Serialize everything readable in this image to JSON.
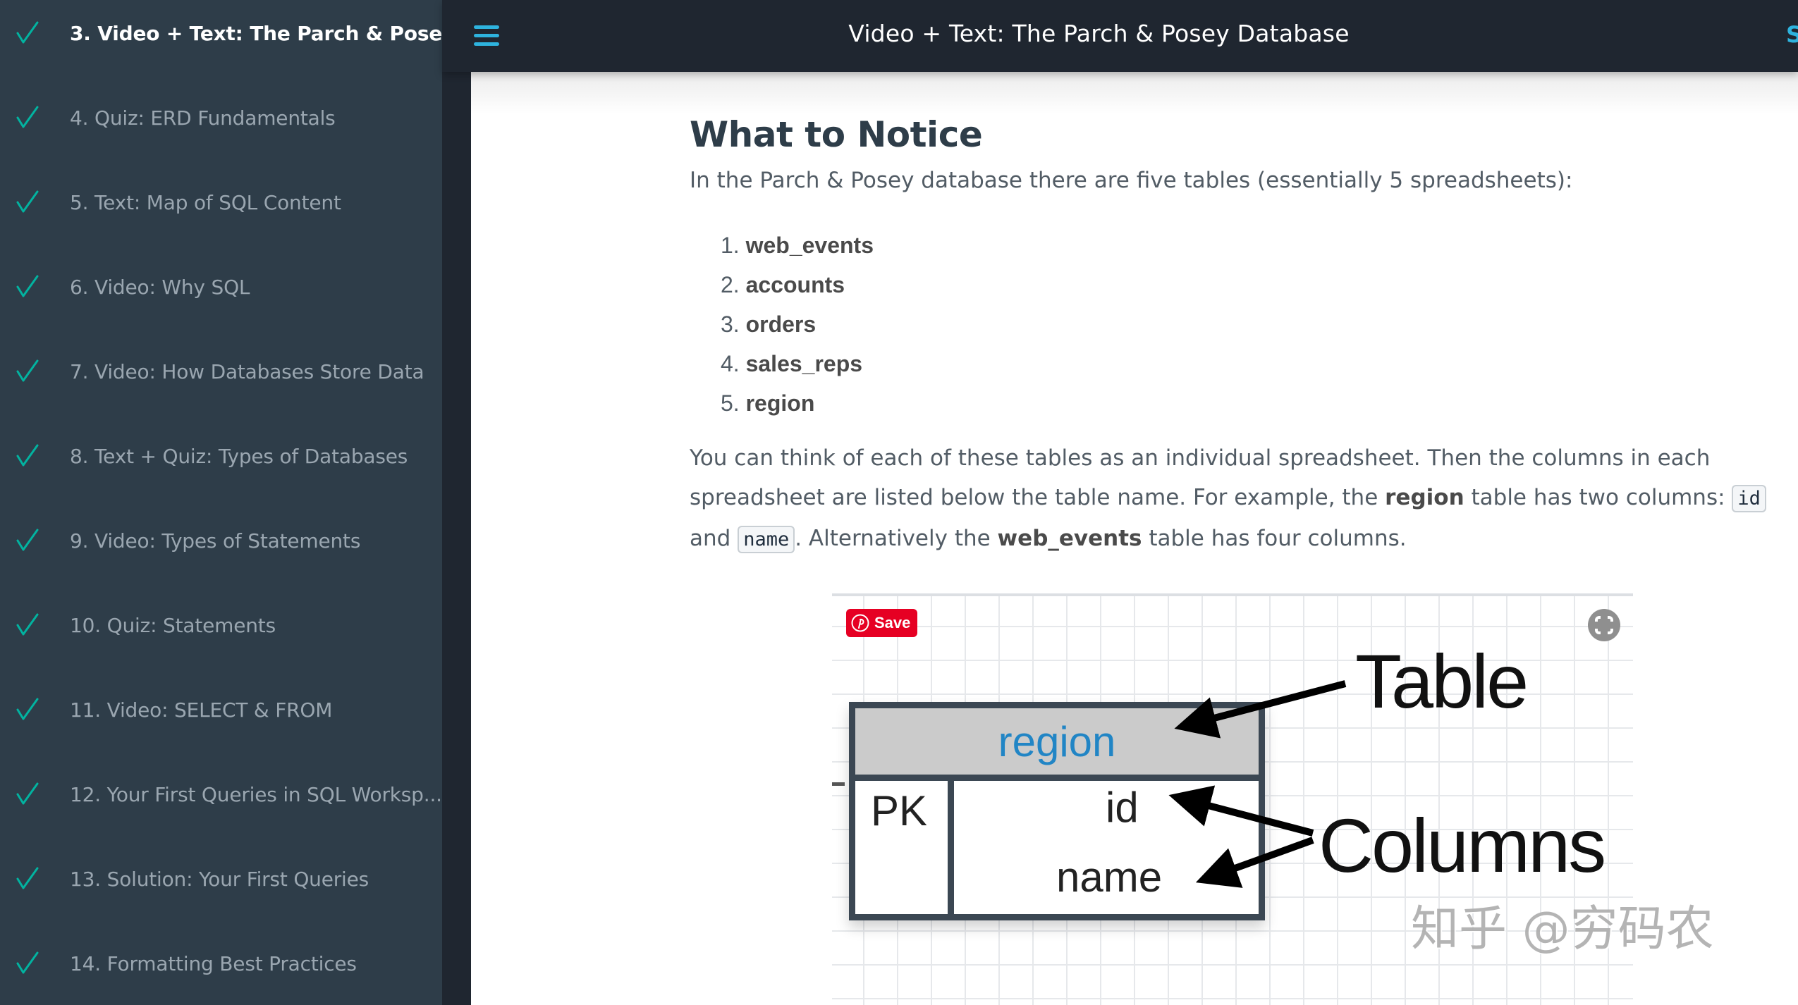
{
  "sidebar": {
    "items": [
      {
        "label": "3. Video + Text: The Parch & Posey ...",
        "completed": true,
        "active": true
      },
      {
        "label": "4. Quiz: ERD Fundamentals",
        "completed": true,
        "active": false
      },
      {
        "label": "5. Text: Map of SQL Content",
        "completed": true,
        "active": false
      },
      {
        "label": "6. Video: Why SQL",
        "completed": true,
        "active": false
      },
      {
        "label": "7. Video: How Databases Store Data",
        "completed": true,
        "active": false
      },
      {
        "label": "8. Text + Quiz: Types of Databases",
        "completed": true,
        "active": false
      },
      {
        "label": "9. Video: Types of Statements",
        "completed": true,
        "active": false
      },
      {
        "label": "10. Quiz: Statements",
        "completed": true,
        "active": false
      },
      {
        "label": "11. Video: SELECT & FROM",
        "completed": true,
        "active": false
      },
      {
        "label": "12. Your First Queries in SQL Worksp...",
        "completed": true,
        "active": false
      },
      {
        "label": "13. Solution: Your First Queries",
        "completed": true,
        "active": false
      },
      {
        "label": "14. Formatting Best Practices",
        "completed": true,
        "active": false
      }
    ],
    "check_color": "#02b3a0"
  },
  "header": {
    "menu_icon": "hamburger-icon",
    "title": "Video + Text: The Parch & Posey Database",
    "right_text": "S"
  },
  "content": {
    "heading": "What to Notice",
    "intro": "In the Parch & Posey database there are five tables (essentially 5 spreadsheets):",
    "tables": [
      {
        "num": "1.",
        "name": "web_events"
      },
      {
        "num": "2.",
        "name": "accounts"
      },
      {
        "num": "3.",
        "name": "orders"
      },
      {
        "num": "4.",
        "name": "sales_reps"
      },
      {
        "num": "5.",
        "name": "region"
      }
    ],
    "para": {
      "p1": "You can think of each of these tables as an individual spreadsheet. Then the columns in each spreadsheet are listed below the table name. For example, the ",
      "b1": "region",
      "p2": " table has two columns: ",
      "code1": "id",
      "p3": " and ",
      "code2": "name",
      "p4": ". Alternatively the ",
      "b2": "web_events",
      "p5": " table has four columns."
    }
  },
  "diagram": {
    "save_button": "Save",
    "save_icon": "pinterest-icon",
    "expand_icon": "expand-icon",
    "table_name": "region",
    "pk_label": "PK",
    "columns": [
      "id",
      "name"
    ],
    "label_table": "Table",
    "label_columns": "Columns"
  },
  "watermark": "知乎 @穷码农",
  "colors": {
    "sidebar_bg": "#2e3d49",
    "header_bg": "#1f2630",
    "accent": "#2eb3de",
    "check": "#02b3a0",
    "pin_red": "#e60023"
  }
}
